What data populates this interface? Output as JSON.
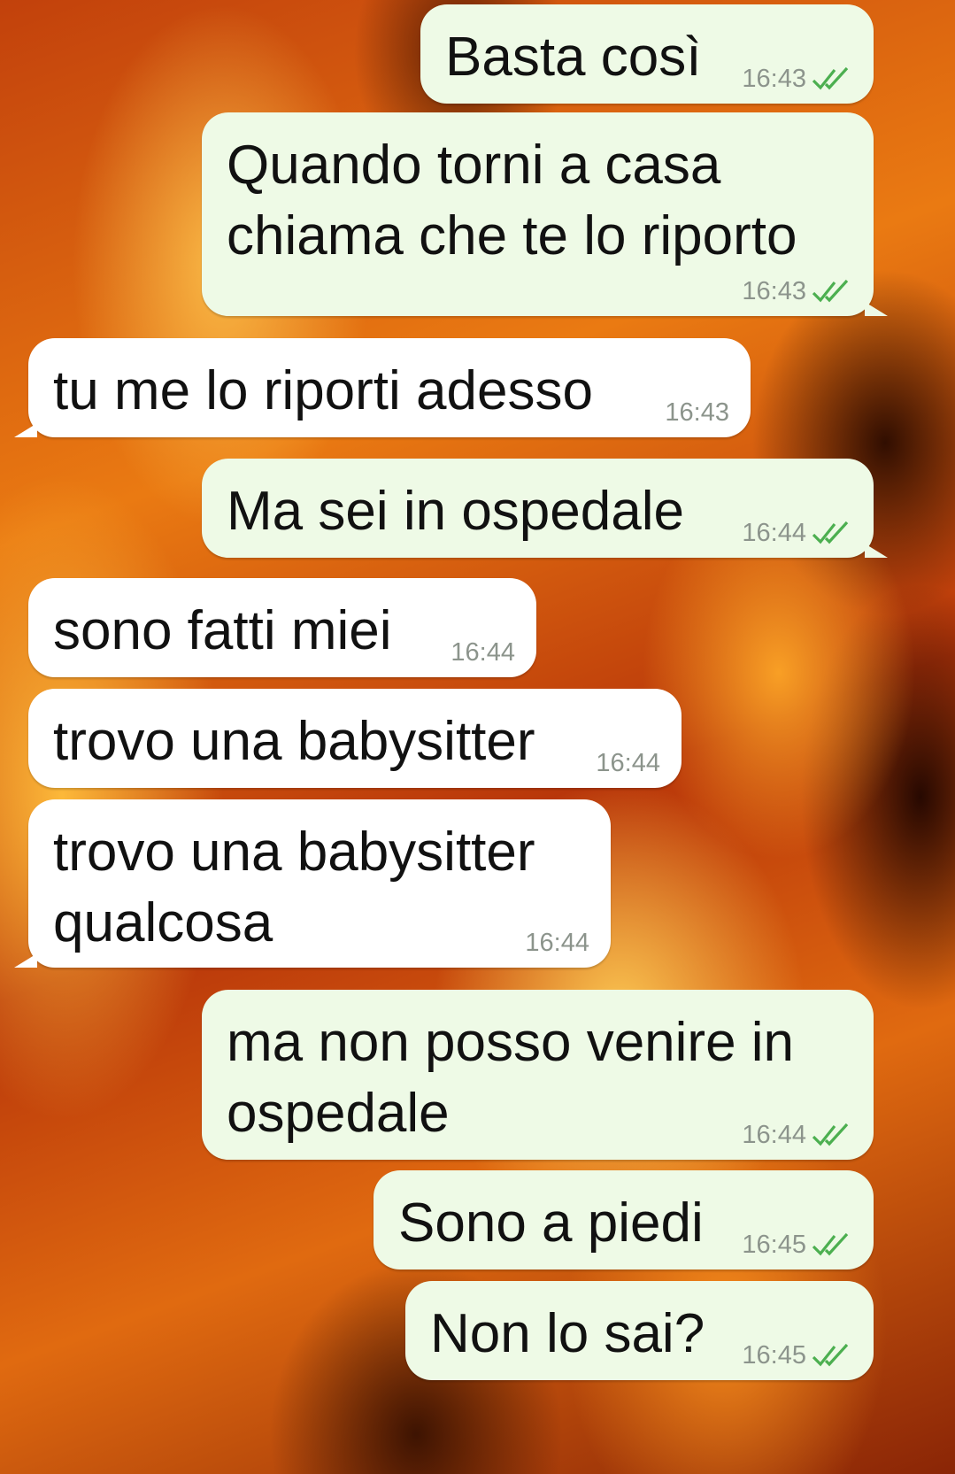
{
  "chat": {
    "messages": [
      {
        "text": "Basta così",
        "time": "16:43",
        "direction": "outgoing",
        "status": "read"
      },
      {
        "text": "Quando torni a casa\nchiama che te lo riporto",
        "time": "16:43",
        "direction": "outgoing",
        "status": "read"
      },
      {
        "text": "tu me lo riporti adesso",
        "time": "16:43",
        "direction": "incoming"
      },
      {
        "text": "Ma sei in ospedale",
        "time": "16:44",
        "direction": "outgoing",
        "status": "read"
      },
      {
        "text": "sono fatti miei",
        "time": "16:44",
        "direction": "incoming"
      },
      {
        "text": "trovo una babysitter",
        "time": "16:44",
        "direction": "incoming"
      },
      {
        "text": "trovo una babysitter\nqualcosa",
        "time": "16:44",
        "direction": "incoming"
      },
      {
        "text": "ma non posso venire in\nospedale",
        "time": "16:44",
        "direction": "outgoing",
        "status": "read"
      },
      {
        "text": "Sono a piedi",
        "time": "16:45",
        "direction": "outgoing",
        "status": "read"
      },
      {
        "text": "Non lo sai?",
        "time": "16:45",
        "direction": "outgoing",
        "status": "read"
      }
    ]
  },
  "colors": {
    "outgoing_bubble": "#eefae6",
    "incoming_bubble": "#ffffff",
    "timestamp": "#8c948c",
    "read_ticks": "#4caf50"
  },
  "icons": {
    "read_status": "double-check-icon",
    "background": "fire-flames-wallpaper"
  }
}
